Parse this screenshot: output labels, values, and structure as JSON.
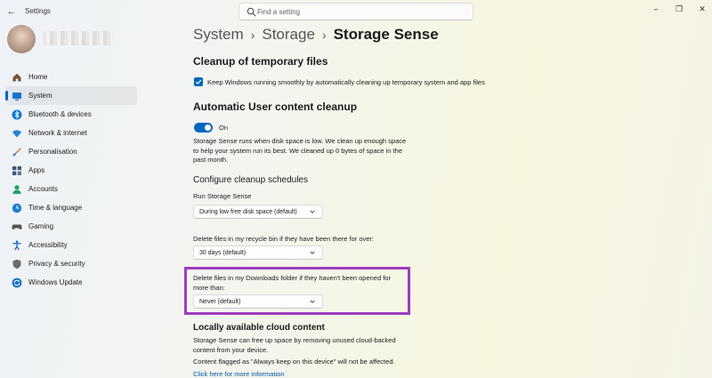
{
  "window": {
    "title": "Settings",
    "back_glyph": "←",
    "controls": [
      "–",
      "❐",
      "✕"
    ]
  },
  "search": {
    "placeholder": "Find a setting"
  },
  "sidebar": {
    "items": [
      {
        "label": "Home",
        "icon": "home-icon",
        "color": "#7a4f2e"
      },
      {
        "label": "System",
        "icon": "monitor-icon",
        "color": "#1a73c8",
        "active": true
      },
      {
        "label": "Bluetooth & devices",
        "icon": "bluetooth-icon",
        "color": "#0a78d4"
      },
      {
        "label": "Network & internet",
        "icon": "wifi-icon",
        "color": "#1f85d6"
      },
      {
        "label": "Personalisation",
        "icon": "brush-icon",
        "color": "#d07b2a"
      },
      {
        "label": "Apps",
        "icon": "apps-icon",
        "color": "#3b5a7a"
      },
      {
        "label": "Accounts",
        "icon": "person-icon",
        "color": "#1ea362"
      },
      {
        "label": "Time & language",
        "icon": "globe-clock-icon",
        "color": "#1f7fd0"
      },
      {
        "label": "Gaming",
        "icon": "gamepad-icon",
        "color": "#555555"
      },
      {
        "label": "Accessibility",
        "icon": "accessibility-icon",
        "color": "#1a6fc4"
      },
      {
        "label": "Privacy & security",
        "icon": "shield-icon",
        "color": "#6a6a6a"
      },
      {
        "label": "Windows Update",
        "icon": "sync-icon",
        "color": "#1a73c8"
      }
    ]
  },
  "breadcrumb": {
    "items": [
      "System",
      "Storage"
    ],
    "current": "Storage Sense",
    "separator": "›"
  },
  "cleanup": {
    "heading": "Cleanup of temporary files",
    "checkbox_label": "Keep Windows running smoothly by automatically cleaning up temporary system and app files"
  },
  "auto_cleanup": {
    "heading": "Automatic User content cleanup",
    "toggle_label": "On",
    "description_lines": [
      "Storage Sense runs when disk space is low. We clean up enough space",
      "to help your system run its best. We cleaned up 0 bytes of space in the",
      "past month."
    ]
  },
  "schedules": {
    "heading": "Configure cleanup schedules",
    "run_label": "Run Storage Sense",
    "run_value": "During low free disk space (default)",
    "recycle_label": "Delete files in my recycle bin if they have been there for over:",
    "recycle_value": "30 days (default)",
    "downloads_label_lines": [
      "Delete files in my Downloads folder if they haven't been opened for",
      "more than:"
    ],
    "downloads_value": "Never (default)"
  },
  "cloud": {
    "heading": "Locally available cloud content",
    "description_lines": [
      "Storage Sense can free up space by removing unused cloud-backed",
      "content from your device."
    ],
    "note": "Content flagged as \"Always keep on this device\" will not be affected.",
    "link": "Click here for more information"
  },
  "colors": {
    "accent": "#0067c0",
    "highlight": "#9b3dbf",
    "link": "#0057a8"
  }
}
